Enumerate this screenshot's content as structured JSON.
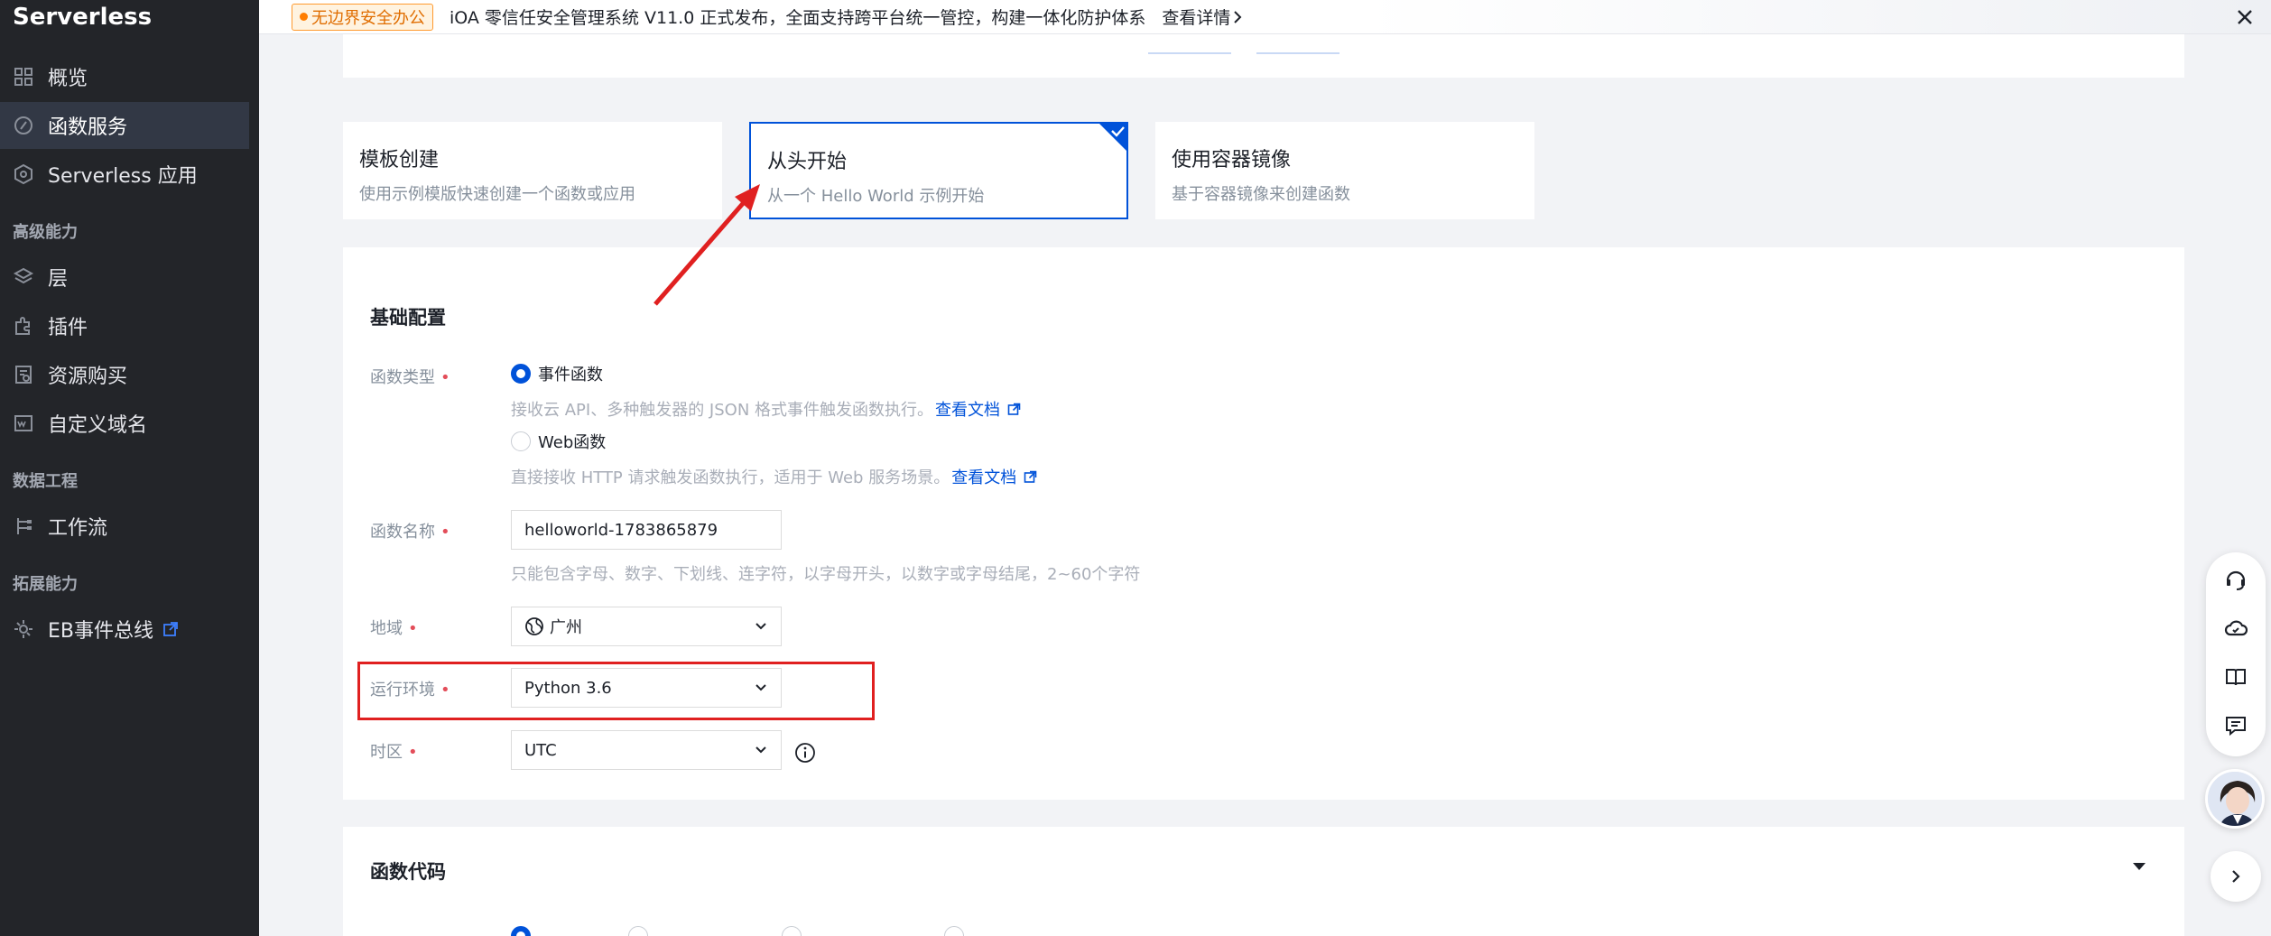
{
  "sidebar": {
    "brand": "Serverless",
    "items": [
      {
        "label": "概览",
        "icon": "grid-icon"
      },
      {
        "label": "函数服务",
        "icon": "function-icon",
        "active": true
      },
      {
        "label": "Serverless 应用",
        "icon": "app-icon"
      }
    ],
    "group_advanced": "高级能力",
    "advanced_items": [
      {
        "label": "层",
        "icon": "layers-icon"
      },
      {
        "label": "插件",
        "icon": "plugin-icon"
      },
      {
        "label": "资源购买",
        "icon": "purchase-icon"
      },
      {
        "label": "自定义域名",
        "icon": "domain-icon"
      }
    ],
    "group_data": "数据工程",
    "data_items": [
      {
        "label": "工作流",
        "icon": "workflow-icon"
      }
    ],
    "group_ext": "拓展能力",
    "ext_items": [
      {
        "label": "EB事件总线",
        "icon": "eventbus-icon"
      }
    ]
  },
  "banner": {
    "tag": "无边界安全办公",
    "text": "iOA 零信任安全管理系统 V11.0 正式发布，全面支持跨平台统一管控，构建一体化防护体系",
    "link": "查看详情"
  },
  "create_options": [
    {
      "title": "模板创建",
      "desc": "使用示例模版快速创建一个函数或应用",
      "selected": false
    },
    {
      "title": "从头开始",
      "desc": "从一个 Hello World 示例开始",
      "selected": true
    },
    {
      "title": "使用容器镜像",
      "desc": "基于容器镜像来创建函数",
      "selected": false
    }
  ],
  "basic_config": {
    "title": "基础配置",
    "function_type": {
      "label": "函数类型",
      "options": [
        {
          "label": "事件函数",
          "checked": true,
          "help": "接收云 API、多种触发器的 JSON 格式事件触发函数执行。",
          "link": "查看文档"
        },
        {
          "label": "Web函数",
          "checked": false,
          "help": "直接接收 HTTP 请求触发函数执行，适用于 Web 服务场景。",
          "link": "查看文档"
        }
      ]
    },
    "function_name": {
      "label": "函数名称",
      "value": "helloworld-1783865879",
      "help": "只能包含字母、数字、下划线、连字符，以字母开头，以数字或字母结尾，2~60个字符"
    },
    "region": {
      "label": "地域",
      "value": "广州"
    },
    "runtime": {
      "label": "运行环境",
      "value": "Python 3.6"
    },
    "timezone": {
      "label": "时区",
      "value": "UTC"
    }
  },
  "function_code": {
    "title": "函数代码"
  },
  "float_toolbar": {
    "items": [
      "support-icon",
      "cloud-icon",
      "book-icon",
      "feedback-icon"
    ]
  },
  "colors": {
    "primary": "#0052d9",
    "sidebar_bg": "#232529",
    "highlight": "#e02020",
    "required": "#e34d59"
  }
}
